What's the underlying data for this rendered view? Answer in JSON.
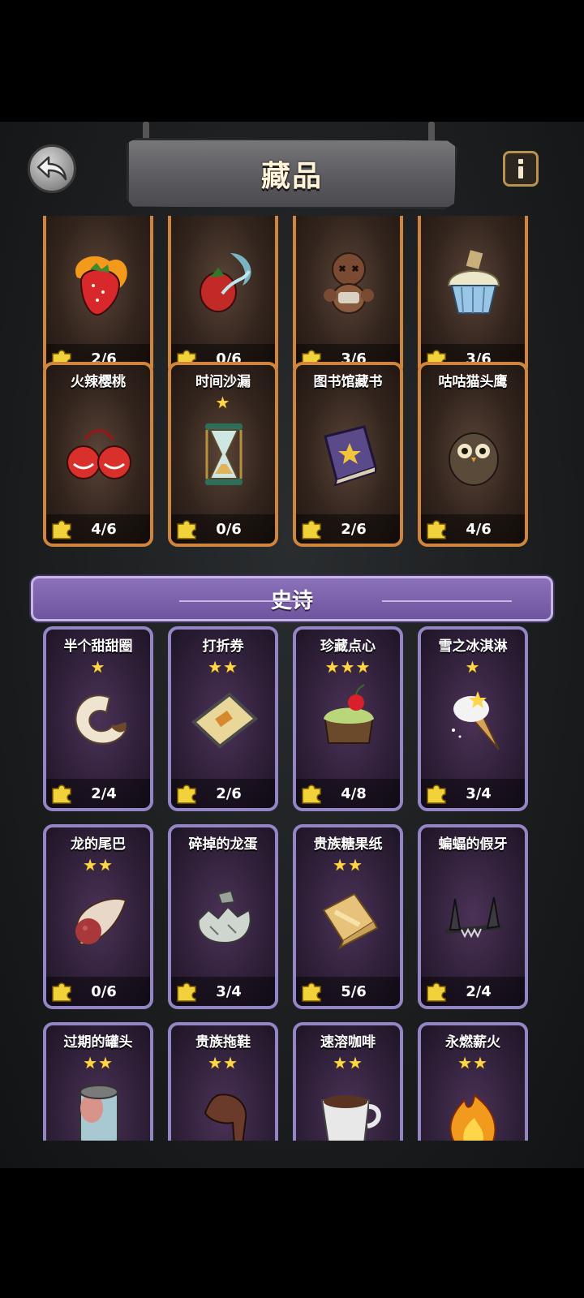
{
  "header": {
    "title": "藏品"
  },
  "rows_rare_top": [
    {
      "name": "",
      "stars": "",
      "count": "2/6",
      "art": "strawberry-icon"
    },
    {
      "name": "",
      "stars": "",
      "count": "0/6",
      "art": "splash-fruit-icon"
    },
    {
      "name": "",
      "stars": "",
      "count": "3/6",
      "art": "voodoo-doll-icon"
    },
    {
      "name": "",
      "stars": "",
      "count": "3/6",
      "art": "cupcake-icon"
    }
  ],
  "rows_rare_second": [
    {
      "name": "火辣樱桃",
      "stars": "",
      "count": "4/6",
      "art": "cherry-icon"
    },
    {
      "name": "时间沙漏",
      "stars": "★",
      "count": "0/6",
      "art": "hourglass-icon"
    },
    {
      "name": "图书馆藏书",
      "stars": "",
      "count": "2/6",
      "art": "book-icon"
    },
    {
      "name": "咕咕猫头鹰",
      "stars": "",
      "count": "4/6",
      "art": "owl-icon"
    }
  ],
  "section_epic": {
    "title": "史诗"
  },
  "rows_epic_1": [
    {
      "name": "半个甜甜圈",
      "stars": "★",
      "count": "2/4",
      "art": "donut-icon"
    },
    {
      "name": "打折券",
      "stars": "★★",
      "count": "2/6",
      "art": "coupon-icon"
    },
    {
      "name": "珍藏点心",
      "stars": "★★★",
      "count": "4/8",
      "art": "cake-icon"
    },
    {
      "name": "雪之冰淇淋",
      "stars": "★",
      "count": "3/4",
      "art": "ice-cream-icon"
    }
  ],
  "rows_epic_2": [
    {
      "name": "龙的尾巴",
      "stars": "★★",
      "count": "0/6",
      "art": "meat-icon"
    },
    {
      "name": "碎掉的龙蛋",
      "stars": "",
      "count": "3/4",
      "art": "egg-icon"
    },
    {
      "name": "贵族糖果纸",
      "stars": "★★",
      "count": "5/6",
      "art": "wrapper-icon"
    },
    {
      "name": "蝙蝠的假牙",
      "stars": "",
      "count": "2/4",
      "art": "fangs-icon"
    }
  ],
  "rows_epic_3": [
    {
      "name": "过期的罐头",
      "stars": "★★",
      "count": "",
      "art": "can-icon"
    },
    {
      "name": "贵族拖鞋",
      "stars": "★★",
      "count": "",
      "art": "slipper-icon"
    },
    {
      "name": "速溶咖啡",
      "stars": "★★",
      "count": "",
      "art": "coffee-icon"
    },
    {
      "name": "永燃薪火",
      "stars": "★★",
      "count": "",
      "art": "fire-icon"
    }
  ]
}
